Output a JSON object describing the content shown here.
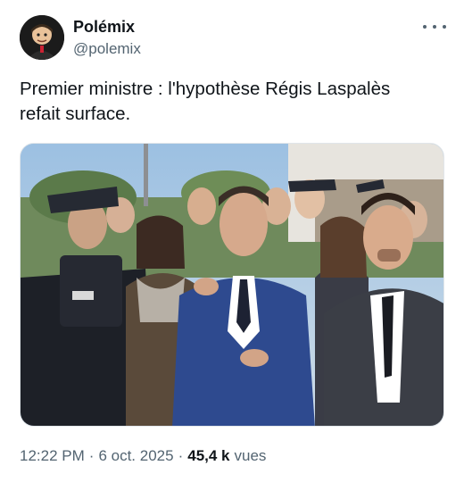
{
  "author": {
    "display_name": "Polémix",
    "handle": "@polemix",
    "avatar_icon": "avatar-caricature"
  },
  "menu_icon": "more-dots-icon",
  "tweet": {
    "text": "Premier ministre : l'hypothèse Régis Laspalès\nrefait surface."
  },
  "media": {
    "kind": "photo",
    "icon": "photo-image"
  },
  "meta": {
    "time": "12:22 PM",
    "separator": "·",
    "date": "6 oct. 2025",
    "views_count": "45,4 k",
    "views_label": "vues"
  },
  "colors": {
    "text_primary": "#0f1419",
    "text_secondary": "#536471",
    "background": "#ffffff"
  }
}
